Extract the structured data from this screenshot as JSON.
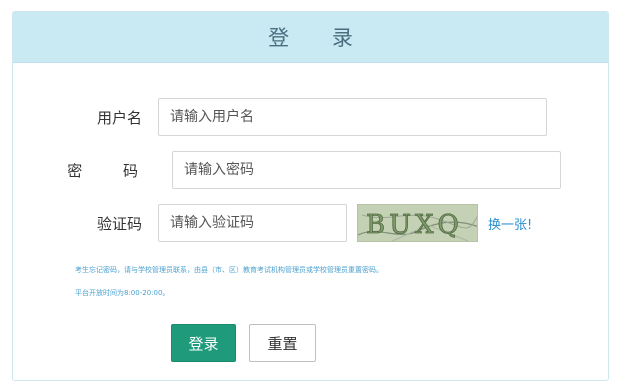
{
  "header": {
    "title": "登  录"
  },
  "form": {
    "username": {
      "label": "用户名",
      "placeholder": "请输入用户名"
    },
    "password": {
      "label": "密 码",
      "placeholder": "请输入密码"
    },
    "captcha": {
      "label": "验证码",
      "placeholder": "请输入验证码",
      "image_text": "BUXQ",
      "refresh_label": "换一张!"
    }
  },
  "notices": {
    "line1": "考生忘记密码，请与学校管理员联系，由县（市、区）教育考试机构管理员或学校管理员重置密码。",
    "line2": "平台开放时间为8:00-20:00。"
  },
  "buttons": {
    "login": "登录",
    "reset": "重置"
  },
  "colors": {
    "header_bg": "#c9e9f3",
    "primary": "#1f9b7c",
    "link": "#2a90d0"
  }
}
